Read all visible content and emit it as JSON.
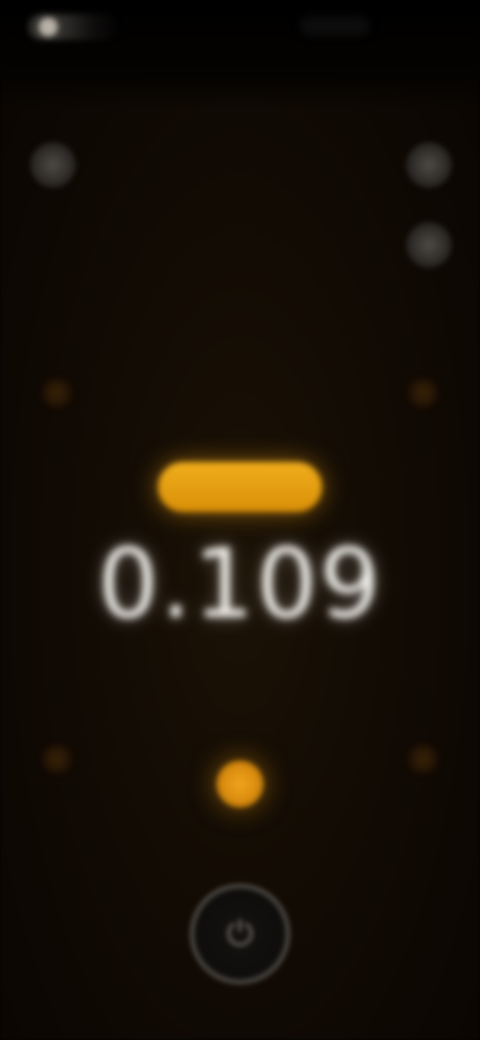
{
  "status_bar": {
    "status_icon": "status-indicator-icon"
  },
  "toolbar": {
    "left_button_icon": "settings-icon",
    "right_top_button_icon": "menu-icon",
    "right_bottom_button_icon": "history-icon"
  },
  "meter": {
    "mode_label": "",
    "reading": "0.109",
    "info_lines": [
      "",
      "",
      ""
    ]
  },
  "controls": {
    "record_icon": "record-icon",
    "power_icon": "power-icon"
  },
  "colors": {
    "accent": "#f0a31c",
    "background": "#120b04",
    "text": "#f3f1ec"
  }
}
